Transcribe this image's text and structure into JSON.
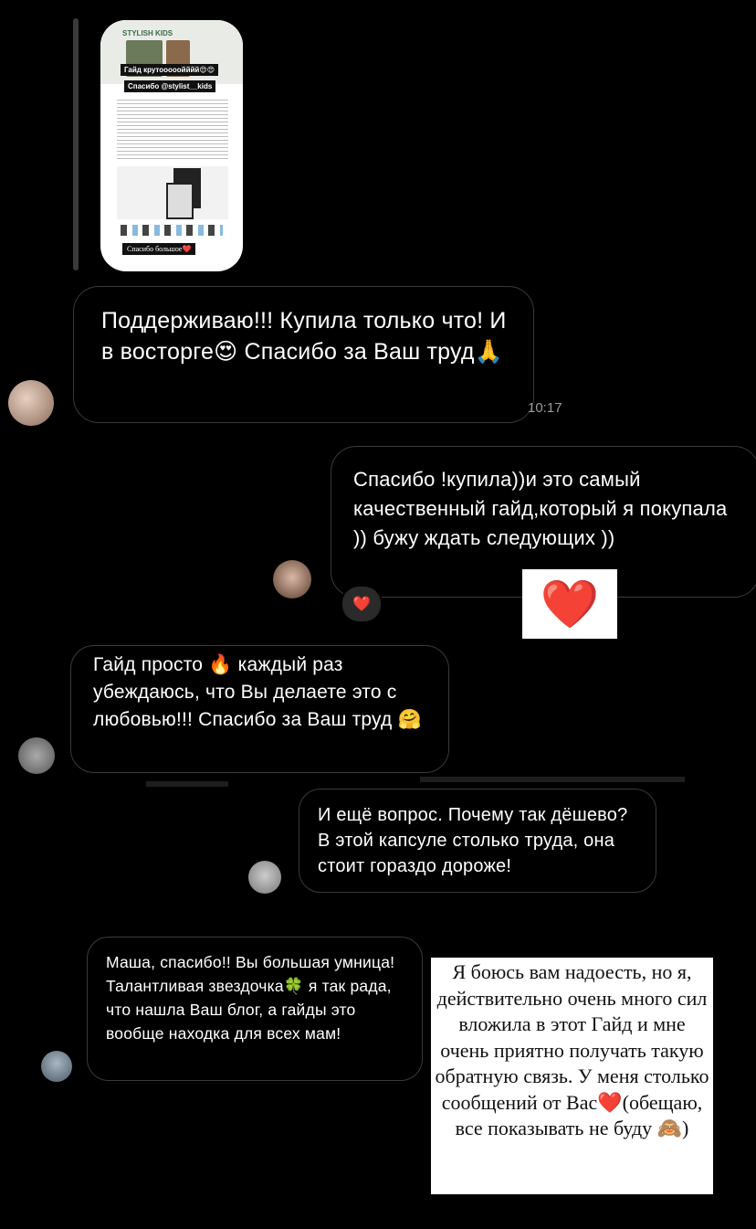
{
  "story_preview": {
    "brand": "STYLISH KIDS",
    "caption1": "Гайд крутооооойййй😍😍",
    "caption2": "Спасибо @stylist__kids",
    "footer": "Спасибо большое❤️",
    "colors": {
      "header_green": "#3b6b4a",
      "caption_bg": "#111111"
    }
  },
  "messages": [
    {
      "text": "Поддерживаю!!! Купила только что! И в восторге😍 Спасибо за Ваш труд🙏",
      "time": "10:17"
    },
    {
      "text": "Спасибо !купила))и это самый качественный гайд,который я покупала )) бужу ждать следующих ))",
      "reaction": "❤️"
    },
    {
      "text": "Гайд просто 🔥 каждый раз убеждаюсь, что Вы делаете это с любовью!!! Спасибо за Ваш труд 🤗"
    },
    {
      "text": "И ещё вопрос. Почему так дёшево? В этой капсуле столько труда, она стоит гораздо дороже!"
    },
    {
      "text": "Маша, спасибо!! Вы большая умница! Талантливая звездочка🍀 я так рада, что нашла Ваш блог, а гайды это вообще находка для всех мам!"
    }
  ],
  "sticker_heart": "❤️",
  "author_note": "Я боюсь вам надоесть, но я, действительно очень много сил вложила в этот Гайд и мне очень приятно получать такую обратную связь. У меня столько сообщений от Вас❤️(обещаю, все показывать не буду 🙈)",
  "icons": {
    "heart": "heart-icon"
  }
}
